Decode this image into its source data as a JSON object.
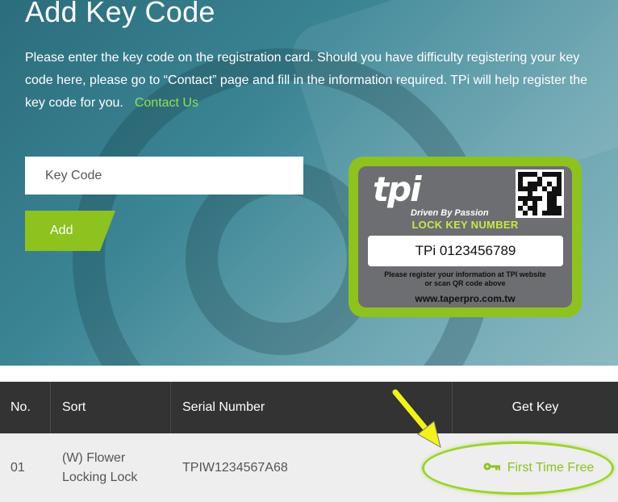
{
  "hero": {
    "title": "Add Key Code",
    "description": "Please enter the key code on the registration card. Should you have difficulty registering your key code here, please go to “Contact” page and fill in the information required. TPi will help register the key code for you.",
    "contact_link": "Contact Us",
    "key_input_placeholder": "Key Code",
    "key_input_value": "",
    "add_button": "Add"
  },
  "card": {
    "logo": "tpi",
    "tagline": "Driven By Passion",
    "lock_label": "LOCK KEY NUMBER",
    "number": "TPi 0123456789",
    "note_line1": "Please register your information at TPI website",
    "note_line2": "or scan QR code above",
    "url": "www.taperpro.com.tw",
    "colors": {
      "frame": "#8dc21f",
      "panel": "#6d6e71"
    }
  },
  "table": {
    "headers": {
      "no": "No.",
      "sort": "Sort",
      "serial": "Serial Number",
      "get_key": "Get Key"
    },
    "rows": [
      {
        "no": "01",
        "sort_line1": "(W) Flower",
        "sort_line2": "Locking Lock",
        "serial": "TPIW1234567A68",
        "get_key": "First Time Free",
        "icon": "key-icon"
      }
    ]
  },
  "colors": {
    "accent": "#8dc21f",
    "header_bg": "#333333",
    "row_bg": "#eeeeee",
    "link_green": "#8fe05a"
  }
}
